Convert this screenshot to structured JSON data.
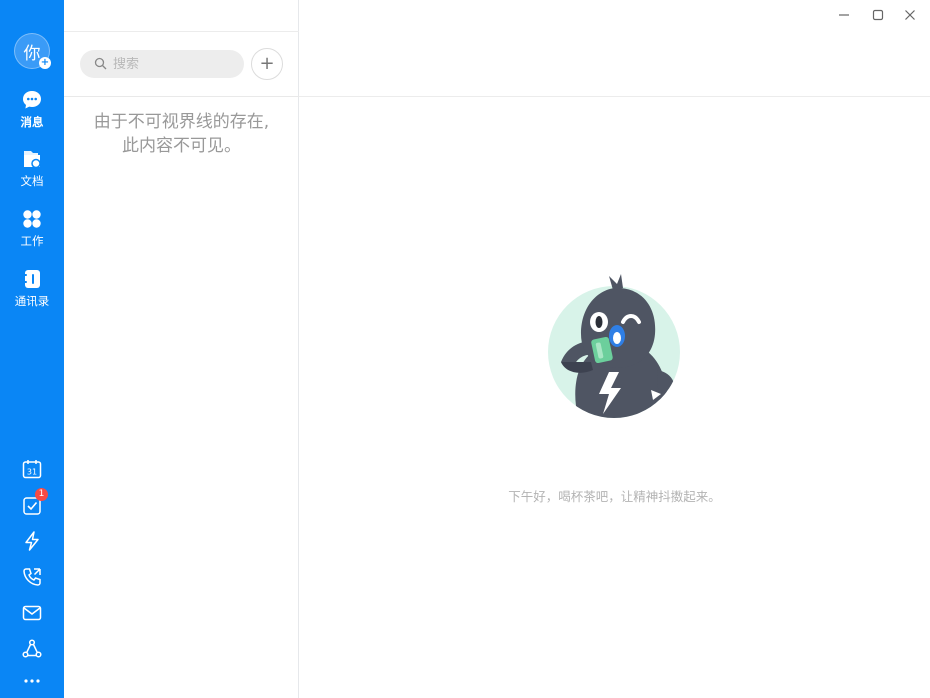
{
  "sidebar": {
    "avatar_text": "你",
    "avatar_badge": "+",
    "items": [
      {
        "label": "消息",
        "icon": "chat-bubble-icon",
        "active": true
      },
      {
        "label": "文档",
        "icon": "document-folder-icon"
      },
      {
        "label": "工作",
        "icon": "apps-grid-icon"
      },
      {
        "label": "通讯录",
        "icon": "contacts-book-icon"
      }
    ],
    "tools": [
      {
        "icon": "calendar-icon",
        "text": "31"
      },
      {
        "icon": "todo-check-icon",
        "badge": "1"
      },
      {
        "icon": "lightning-icon"
      },
      {
        "icon": "phone-call-icon"
      },
      {
        "icon": "mail-icon"
      },
      {
        "icon": "share-network-icon"
      },
      {
        "icon": "more-dots-icon"
      }
    ],
    "accent_color": "#0a86f5"
  },
  "list": {
    "search_placeholder": "搜索",
    "add_label": "+",
    "invisible_line1": "由于不可视界线的存在,",
    "invisible_line2": "此内容不可见。"
  },
  "main": {
    "greeting": "下午好，喝杯茶吧，让精神抖擞起来。",
    "illustration": "mascot-drinking-tea-icon"
  },
  "window": {
    "controls": [
      "minimize-icon",
      "maximize-icon",
      "close-icon"
    ]
  }
}
